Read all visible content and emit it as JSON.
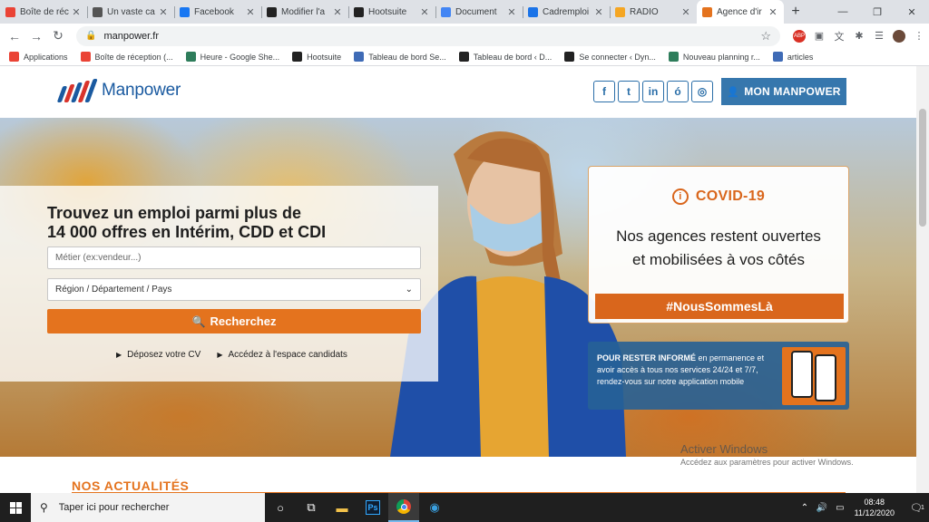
{
  "browser": {
    "tabs": [
      {
        "title": "Boîte de réc",
        "favicon": "gmail-icon",
        "color": "#ea4335"
      },
      {
        "title": "Un vaste ca",
        "favicon": "cart-icon",
        "color": "#555555"
      },
      {
        "title": "Facebook",
        "favicon": "facebook-icon",
        "color": "#1877f2"
      },
      {
        "title": "Modifier l'a",
        "favicon": "d-icon",
        "color": "#222222"
      },
      {
        "title": "Hootsuite",
        "favicon": "hootsuite-icon",
        "color": "#222222"
      },
      {
        "title": "Document",
        "favicon": "docs-icon",
        "color": "#4285f4"
      },
      {
        "title": "Cadremploi",
        "favicon": "cadremploi-icon",
        "color": "#1a73e8"
      },
      {
        "title": "RADIO",
        "favicon": "radio-icon",
        "color": "#f5a623"
      },
      {
        "title": "Agence d'ir",
        "favicon": "manpower-icon",
        "color": "#e4731e"
      }
    ],
    "url": "manpower.fr",
    "bookmarks": [
      {
        "label": "Applications",
        "icon": "apps-grid-icon",
        "color": "#ea4335"
      },
      {
        "label": "Boîte de réception (...",
        "icon": "gmail-icon",
        "color": "#ea4335"
      },
      {
        "label": "Heure - Google She...",
        "icon": "sheets-icon",
        "color": "#2e7d5b"
      },
      {
        "label": "Hootsuite",
        "icon": "hootsuite-icon",
        "color": "#222222"
      },
      {
        "label": "Tableau de bord Se...",
        "icon": "semrush-icon",
        "color": "#3f6bb6"
      },
      {
        "label": "Tableau de bord ‹ D...",
        "icon": "d-icon",
        "color": "#222222"
      },
      {
        "label": "Se connecter ‹ Dyn...",
        "icon": "d-icon",
        "color": "#222222"
      },
      {
        "label": "Nouveau planning r...",
        "icon": "sheets-icon",
        "color": "#2e7d5b"
      },
      {
        "label": "articles",
        "icon": "doc-icon",
        "color": "#3f6bb6"
      }
    ]
  },
  "site": {
    "brand": "Manpower",
    "social": [
      "f",
      "t",
      "in",
      "ó",
      "◎"
    ],
    "login_button": "MON MANPOWER",
    "search": {
      "title_line1": "Trouvez un emploi parmi plus de",
      "title_line2": "14 000 offres en Intérim, CDD et CDI",
      "job_placeholder": "Métier (ex:vendeur...)",
      "region_value": "Région / Département / Pays",
      "button": "Recherchez",
      "link_cv": "Déposez votre CV",
      "link_candidates": "Accédez à l'espace candidats"
    },
    "covid": {
      "heading": "COVID-19",
      "line1": "Nos agences restent ouvertes",
      "line2": "et mobilisées à vos côtés",
      "hashtag": "#NousSommesLà"
    },
    "app_banner": {
      "bold": "POUR RESTER INFORMÉ",
      "rest": " en permanence et avoir accès à tous nos services 24/24 et 7/7, rendez-vous sur notre application mobile"
    },
    "news_heading": "NOS ACTUALITÉS"
  },
  "watermark": {
    "line1": "Activer Windows",
    "line2": "Accédez aux paramètres pour activer Windows."
  },
  "taskbar": {
    "search_placeholder": "Taper ici pour rechercher",
    "time": "08:48",
    "date": "11/12/2020",
    "notifications": "1"
  },
  "colors": {
    "accent_orange": "#e4731e",
    "brand_blue": "#3677ad"
  }
}
